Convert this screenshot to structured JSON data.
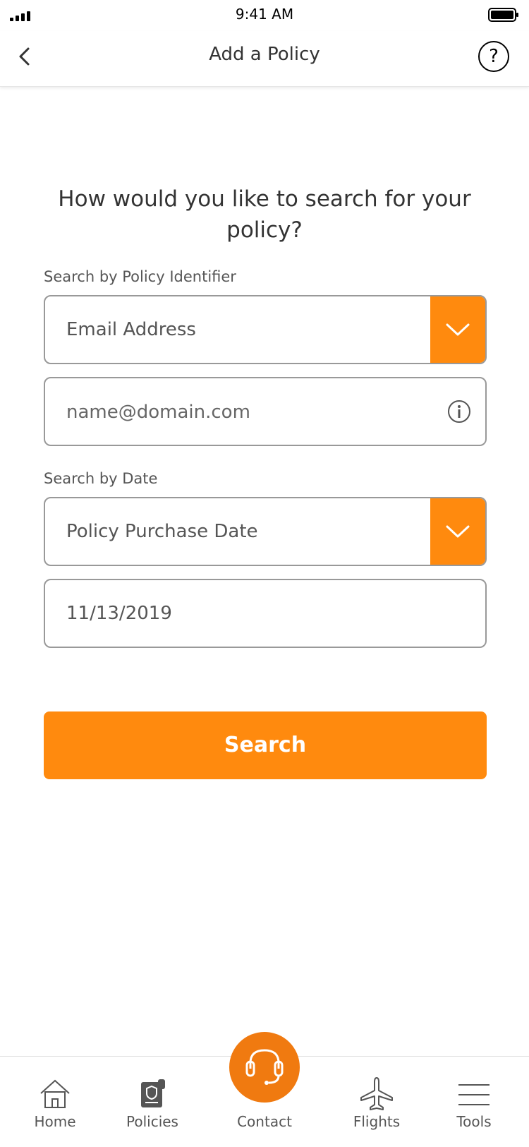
{
  "status": {
    "time": "9:41 AM"
  },
  "nav": {
    "title": "Add a Policy",
    "help": "?"
  },
  "form": {
    "question": "How would you like to search for your policy?",
    "identifier_label": "Search by Policy Identifier",
    "identifier_select": "Email Address",
    "email_placeholder": "name@domain.com",
    "date_label": "Search by Date",
    "date_select": "Policy Purchase Date",
    "date_value": "11/13/2019",
    "search_label": "Search"
  },
  "tabs": [
    {
      "label": "Home",
      "icon": "home-icon"
    },
    {
      "label": "Policies",
      "icon": "policies-icon"
    },
    {
      "label": "Contact",
      "icon": "headset-icon"
    },
    {
      "label": "Flights",
      "icon": "airplane-icon"
    },
    {
      "label": "Tools",
      "icon": "menu-icon"
    }
  ],
  "colors": {
    "accent": "#ff8a0e",
    "contact": "#f07a10",
    "text": "#333333"
  }
}
